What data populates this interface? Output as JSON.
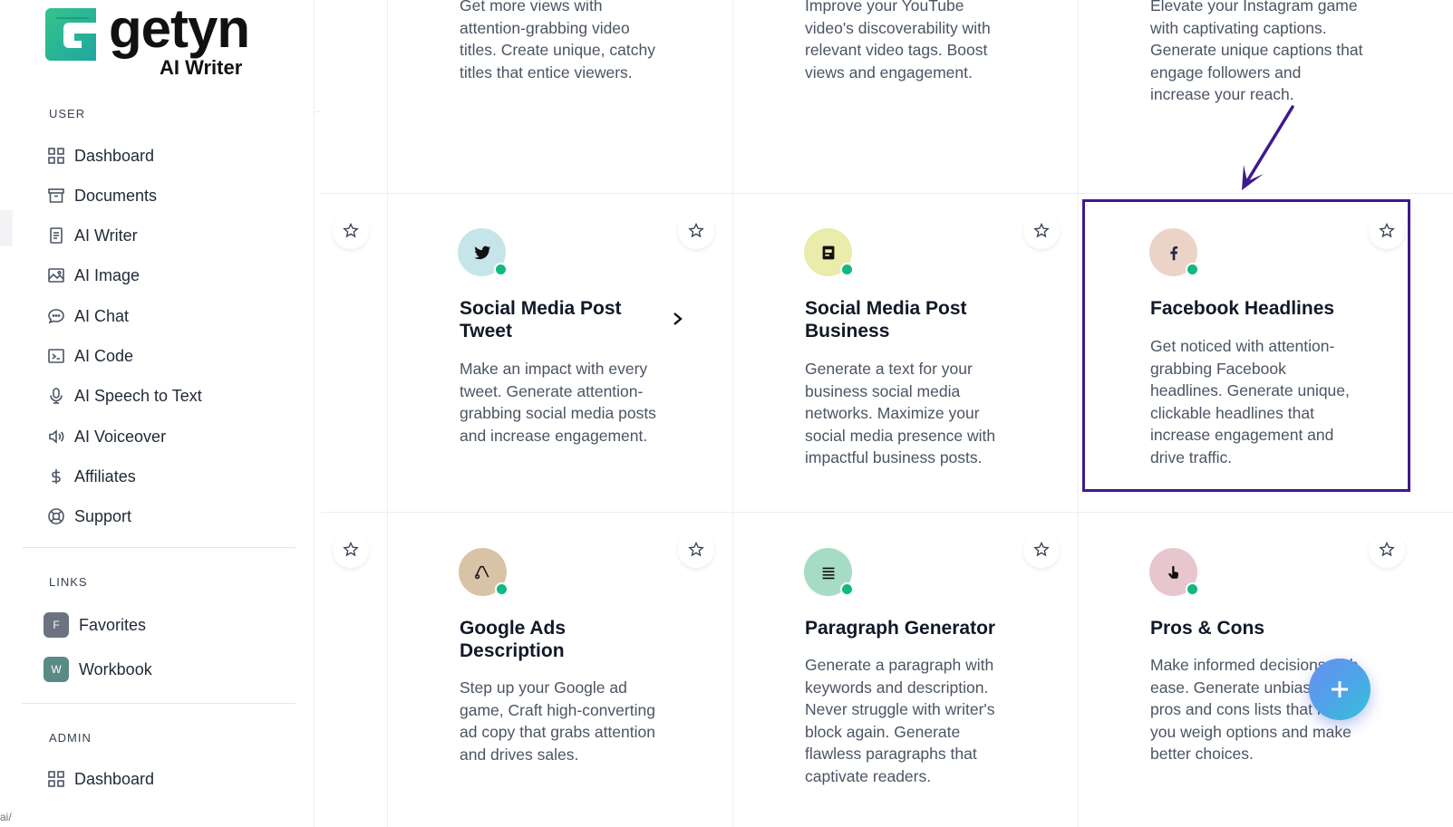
{
  "brand": {
    "name": "getyn",
    "sub": "AI Writer"
  },
  "sidebar": {
    "sections": {
      "user": "USER",
      "links": "LINKS",
      "admin": "ADMIN"
    },
    "user_items": [
      {
        "label": "Dashboard",
        "icon": "grid-icon"
      },
      {
        "label": "Documents",
        "icon": "archive-icon"
      },
      {
        "label": "AI Writer",
        "icon": "file-text-icon"
      },
      {
        "label": "AI Image",
        "icon": "image-icon"
      },
      {
        "label": "AI Chat",
        "icon": "chat-bubble-icon"
      },
      {
        "label": "AI Code",
        "icon": "terminal-icon"
      },
      {
        "label": "AI Speech to Text",
        "icon": "microphone-icon"
      },
      {
        "label": "AI Voiceover",
        "icon": "speaker-icon"
      },
      {
        "label": "Affiliates",
        "icon": "dollar-icon"
      },
      {
        "label": "Support",
        "icon": "lifebuoy-icon"
      }
    ],
    "links": [
      {
        "badge": "F",
        "label": "Favorites",
        "color": "#6b7280"
      },
      {
        "badge": "W",
        "label": "Workbook",
        "color": "#5a8a86"
      }
    ],
    "admin_items": [
      {
        "label": "Dashboard",
        "icon": "grid-icon"
      }
    ],
    "edge_text": "ai/"
  },
  "cards": {
    "top": [
      {
        "desc": "Get more views with attention-grabbing video titles. Create unique, catchy titles that entice viewers."
      },
      {
        "desc": "Improve your YouTube video's discoverability with relevant video tags. Boost views and engagement."
      },
      {
        "desc": "Elevate your Instagram game with captivating captions. Generate unique captions that engage followers and increase your reach."
      }
    ],
    "middle": [
      {
        "title": "Social Media Post Tweet",
        "desc": "Make an impact with every tweet. Generate attention-grabbing social media posts and increase engagement.",
        "avatar_color": "#c6e5e8",
        "icon": "twitter-icon"
      },
      {
        "title": "Social Media Post Business",
        "desc": "Generate a text for your business social media networks. Maximize your social media presence with impactful business posts.",
        "avatar_color": "#e9ecaa",
        "icon": "briefcase-icon"
      },
      {
        "title": "Facebook Headlines",
        "desc": "Get noticed with attention-grabbing Facebook headlines. Generate unique, clickable headlines that increase engagement and drive traffic.",
        "avatar_color": "#ecd3c8",
        "icon": "facebook-icon"
      }
    ],
    "bottom": [
      {
        "title": "Google Ads Description",
        "desc": "Step up your Google ad game, Craft high-converting ad copy that grabs attention and drives sales.",
        "avatar_color": "#d9c3a6",
        "icon": "google-ads-icon"
      },
      {
        "title": "Paragraph Generator",
        "desc": "Generate a paragraph with keywords and description. Never struggle with writer's block again. Generate flawless paragraphs that captivate readers.",
        "avatar_color": "#a6dcc6",
        "icon": "paragraph-icon"
      },
      {
        "title": "Pros & Cons",
        "desc": "Make informed decisions with ease. Generate unbiased pros and cons lists that help you weigh options and make better choices.",
        "avatar_color": "#e8c6cd",
        "icon": "pointer-hand-icon"
      }
    ]
  },
  "colors": {
    "highlight": "#3f1a8c",
    "online": "#10b981"
  }
}
